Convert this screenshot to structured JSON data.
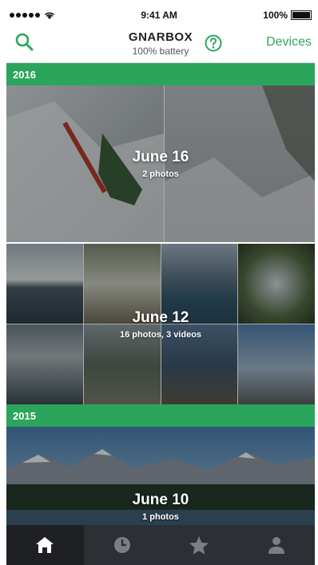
{
  "status": {
    "time": "9:41 AM",
    "battery": "100%",
    "battery_level": 1.0
  },
  "header": {
    "title": "GNARBOX",
    "subtitle": "100% battery",
    "devices_label": "Devices"
  },
  "colors": {
    "accent": "#2ca55c",
    "tabbar": "#2c2f33"
  },
  "sections": [
    {
      "year": "2016",
      "groups": [
        {
          "date": "June 16",
          "count": "2 photos"
        },
        {
          "date": "June 12",
          "count": "16 photos, 3 videos"
        }
      ]
    },
    {
      "year": "2015",
      "groups": [
        {
          "date": "June 10",
          "count": "1 photos"
        }
      ]
    }
  ],
  "tabs": [
    {
      "name": "home",
      "icon": "home-icon",
      "active": true
    },
    {
      "name": "recent",
      "icon": "clock-icon",
      "active": false
    },
    {
      "name": "favorites",
      "icon": "star-icon",
      "active": false
    },
    {
      "name": "profile",
      "icon": "user-icon",
      "active": false
    }
  ]
}
